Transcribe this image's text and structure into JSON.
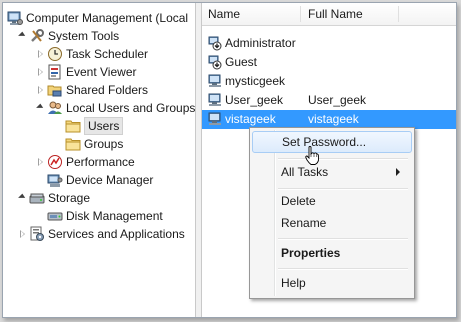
{
  "tree": {
    "root_label": "Computer Management (Local",
    "system_tools": "System Tools",
    "task_scheduler": "Task Scheduler",
    "event_viewer": "Event Viewer",
    "shared_folders": "Shared Folders",
    "local_users_groups": "Local Users and Groups",
    "users": "Users",
    "groups": "Groups",
    "performance": "Performance",
    "device_manager": "Device Manager",
    "storage": "Storage",
    "disk_management": "Disk Management",
    "services_apps": "Services and Applications"
  },
  "list": {
    "col_name": "Name",
    "col_full_name": "Full Name",
    "rows": [
      {
        "name": "Administrator",
        "full": ""
      },
      {
        "name": "Guest",
        "full": ""
      },
      {
        "name": "mysticgeek",
        "full": ""
      },
      {
        "name": "User_geek",
        "full": "User_geek"
      },
      {
        "name": "vistageek",
        "full": "vistageek"
      }
    ]
  },
  "context_menu": {
    "set_password": "Set Password...",
    "all_tasks": "All Tasks",
    "delete": "Delete",
    "rename": "Rename",
    "properties": "Properties",
    "help": "Help"
  },
  "colors": {
    "selection": "#3399ff",
    "menu_hover": "#dcebfc"
  }
}
